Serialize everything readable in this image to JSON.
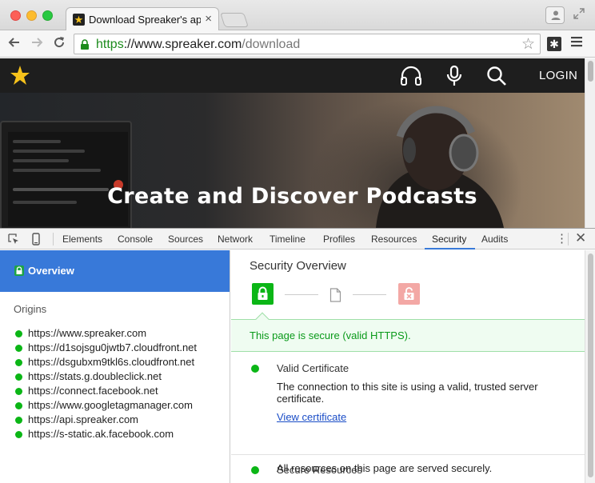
{
  "browser": {
    "tab_title": "Download Spreaker's apps",
    "tab_close": "×",
    "url_scheme": "https",
    "url_sep": "://",
    "url_host": "www.spreaker.com",
    "url_path": "/download"
  },
  "site": {
    "login_label": "LOGIN",
    "hero_title": "Create and Discover Podcasts"
  },
  "devtools": {
    "tabs": [
      "Elements",
      "Console",
      "Sources",
      "Network",
      "Timeline",
      "Profiles",
      "Resources",
      "Security",
      "Audits"
    ],
    "active_tab": "Security",
    "sidebar": {
      "overview_label": "Overview",
      "origins_title": "Origins",
      "origins": [
        "https://www.spreaker.com",
        "https://d1sojsgu0jwtb7.cloudfront.net",
        "https://dsgubxm9tkl6s.cloudfront.net",
        "https://stats.g.doubleclick.net",
        "https://connect.facebook.net",
        "https://www.googletagmanager.com",
        "https://api.spreaker.com",
        "https://s-static.ak.facebook.com"
      ]
    },
    "main": {
      "title": "Security Overview",
      "banner": "This page is secure (valid HTTPS).",
      "certificate_title": "Valid Certificate",
      "certificate_desc": "The connection to this site is using a valid, trusted server certificate.",
      "certificate_link": "View certificate",
      "resources_title": "Secure Resources",
      "resources_desc": "All resources on this page are served securely."
    }
  },
  "colors": {
    "secure_green": "#0bb616",
    "active_blue": "#3879d9",
    "brand_yellow": "#f6c21b"
  }
}
